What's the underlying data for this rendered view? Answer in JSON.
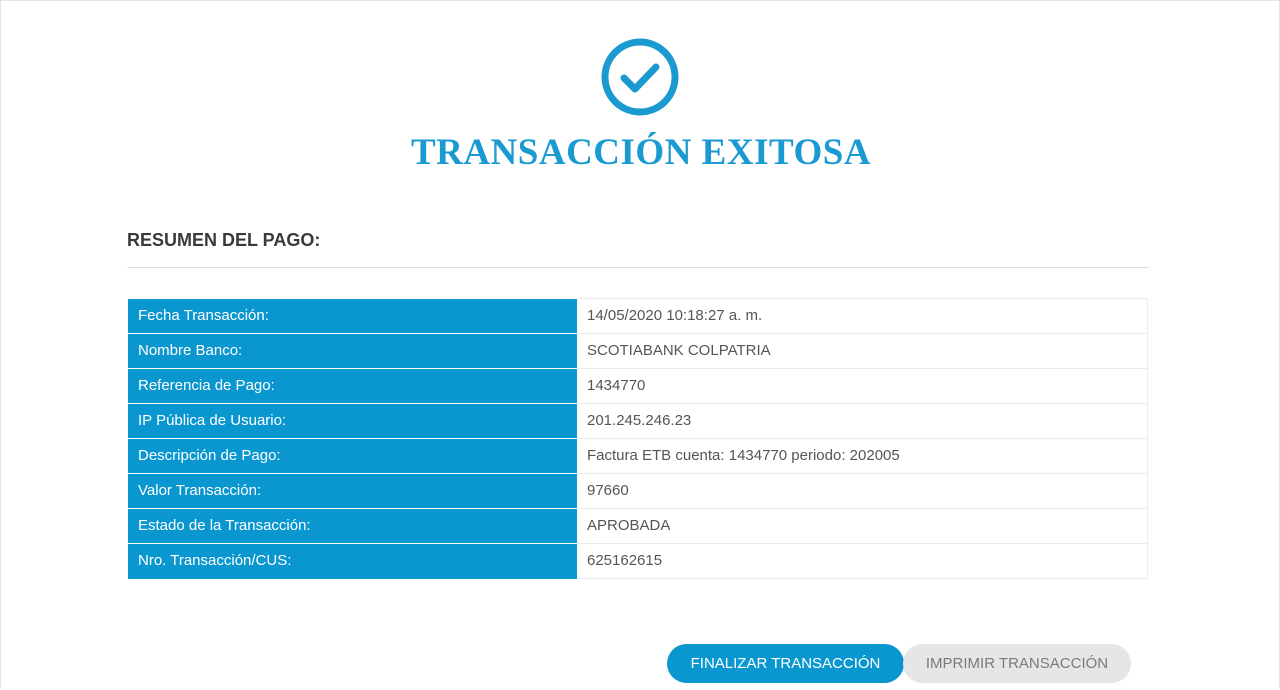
{
  "page": {
    "title": "TRANSACCIÓN EXITOSA",
    "icon": "check-circle-icon",
    "accent_color": "#0a97d0"
  },
  "summary": {
    "heading": "RESUMEN DEL PAGO:",
    "rows": [
      {
        "label": "Fecha Transacción:",
        "value": "14/05/2020 10:18:27 a. m."
      },
      {
        "label": "Nombre Banco:",
        "value": "SCOTIABANK COLPATRIA"
      },
      {
        "label": "Referencia de Pago:",
        "value": "1434770"
      },
      {
        "label": "IP Pública de Usuario:",
        "value": "201.245.246.23"
      },
      {
        "label": "Descripción de Pago:",
        "value": "Factura ETB cuenta: 1434770 periodo: 202005"
      },
      {
        "label": "Valor Transacción:",
        "value": "97660"
      },
      {
        "label": "Estado de la Transacción:",
        "value": "APROBADA"
      },
      {
        "label": "Nro. Transacción/CUS:",
        "value": "625162615"
      }
    ]
  },
  "actions": {
    "finish_label": "FINALIZAR TRANSACCIÓN",
    "print_label": "IMPRIMIR TRANSACCIÓN"
  }
}
